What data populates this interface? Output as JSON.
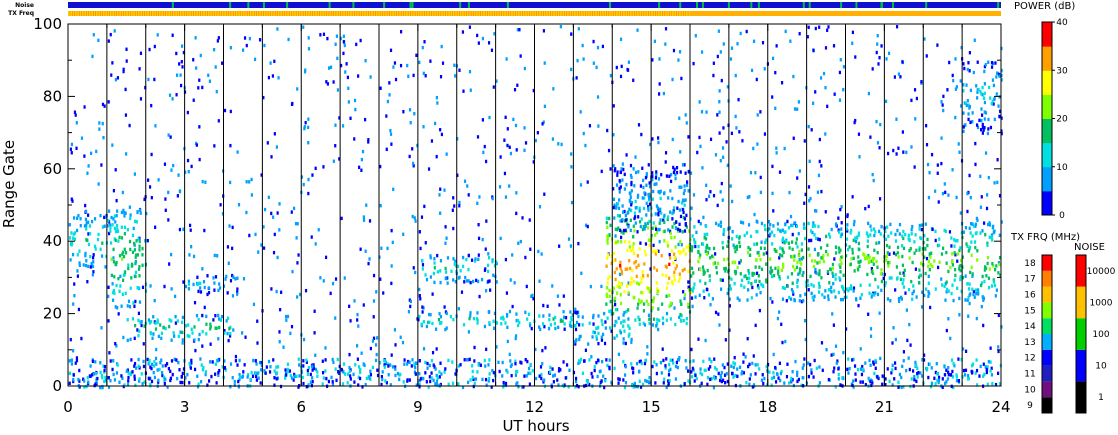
{
  "chart_data": {
    "type": "heatmap",
    "title": "",
    "xlabel": "UT hours",
    "ylabel": "Range Gate",
    "xlim": [
      0,
      24
    ],
    "ylim": [
      0,
      100
    ],
    "x_ticks": [
      "0",
      "3",
      "6",
      "9",
      "12",
      "15",
      "18",
      "21",
      "24"
    ],
    "y_ticks": [
      "0",
      "20",
      "40",
      "60",
      "80",
      "100"
    ],
    "scan_boundaries_ut": [
      1,
      2,
      3,
      4,
      5,
      6,
      7,
      8,
      9,
      10,
      11,
      12,
      13,
      14,
      15,
      16,
      17,
      18,
      19,
      20,
      21,
      22,
      23
    ],
    "top_strips": {
      "noise_label": "Noise",
      "freq_label": "TX Freq"
    },
    "power_colorbar": {
      "title": "POWER (dB)",
      "ticks": [
        "0",
        "10",
        "20",
        "30",
        "40"
      ],
      "range": [
        0,
        40
      ],
      "colors": [
        "#0000ff",
        "#00a0ff",
        "#00e0e0",
        "#00c060",
        "#80ff00",
        "#ffff00",
        "#ffa000",
        "#ff0000"
      ]
    },
    "freq_colorbar": {
      "title": "TX FRQ (MHz)",
      "ticks": [
        "9",
        "10",
        "11",
        "12",
        "13",
        "14",
        "15",
        "16",
        "17",
        "18"
      ],
      "colors": [
        "#000000",
        "#701080",
        "#2020c0",
        "#0000ff",
        "#00b0ff",
        "#00e060",
        "#80ff00",
        "#ffc000",
        "#ff8000",
        "#ff0000"
      ]
    },
    "noise_colorbar": {
      "title": "NOISE",
      "ticks": [
        "1",
        "10",
        "100",
        "1000",
        "10000"
      ],
      "colors": [
        "#000000",
        "#0000ff",
        "#00d000",
        "#ffc000",
        "#ff0000"
      ]
    },
    "echo_regions": [
      {
        "t0": 0.0,
        "t1": 1.0,
        "g0": 33,
        "g1": 48,
        "power": 14
      },
      {
        "t0": 1.0,
        "t1": 2.0,
        "g0": 22,
        "g1": 50,
        "power": 18
      },
      {
        "t0": 1.5,
        "t1": 4.2,
        "g0": 13,
        "g1": 20,
        "power": 16
      },
      {
        "t0": 3.0,
        "t1": 4.5,
        "g0": 26,
        "g1": 31,
        "power": 8
      },
      {
        "t0": 9.0,
        "t1": 11.0,
        "g0": 29,
        "g1": 37,
        "power": 13
      },
      {
        "t0": 9.0,
        "t1": 13.0,
        "g0": 16,
        "g1": 21,
        "power": 14
      },
      {
        "t0": 13.0,
        "t1": 14.5,
        "g0": 12,
        "g1": 21,
        "power": 13
      },
      {
        "t0": 13.8,
        "t1": 16.0,
        "g0": 17,
        "g1": 50,
        "power": 30
      },
      {
        "t0": 14.0,
        "t1": 16.0,
        "g0": 43,
        "g1": 62,
        "power": 8
      },
      {
        "t0": 16.0,
        "t1": 24.0,
        "g0": 24,
        "g1": 46,
        "power": 20
      },
      {
        "t0": 23.0,
        "t1": 24.0,
        "g0": 70,
        "g1": 90,
        "power": 10
      }
    ]
  }
}
